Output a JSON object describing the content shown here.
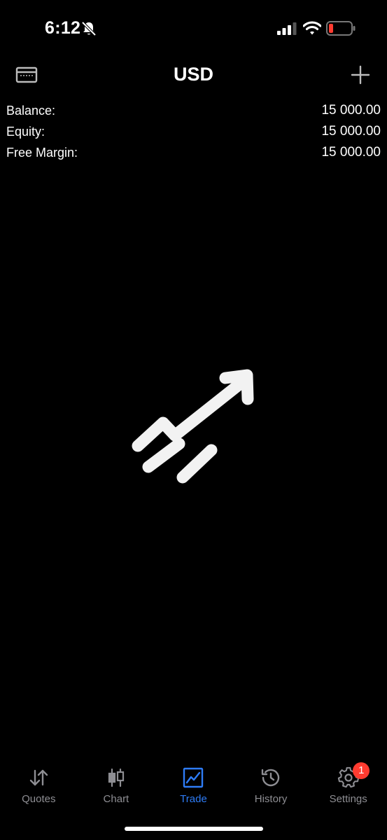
{
  "status_bar": {
    "time": "6:12",
    "icons": [
      "bell-slash-icon",
      "signal-icon",
      "wifi-icon",
      "battery-low-icon"
    ],
    "battery_color": "#ff3b30"
  },
  "header": {
    "title": "USD",
    "left_icon": "card-icon",
    "right_icon": "add-icon"
  },
  "account": {
    "rows": [
      {
        "label": "Balance:",
        "value": "15 000.00"
      },
      {
        "label": "Equity:",
        "value": "15 000.00"
      },
      {
        "label": "Free Margin:",
        "value": "15 000.00"
      }
    ]
  },
  "empty_state": {
    "icon": "trade-trend-icon"
  },
  "tab_bar": {
    "accent_color": "#2e7cf6",
    "inactive_color": "#8e8e93",
    "tabs": [
      {
        "label": "Quotes",
        "icon": "quotes-arrows-icon",
        "active": false
      },
      {
        "label": "Chart",
        "icon": "candlestick-icon",
        "active": false
      },
      {
        "label": "Trade",
        "icon": "trade-chart-icon",
        "active": true
      },
      {
        "label": "History",
        "icon": "history-clock-icon",
        "active": false
      },
      {
        "label": "Settings",
        "icon": "gear-icon",
        "active": false,
        "badge": "1"
      }
    ]
  }
}
